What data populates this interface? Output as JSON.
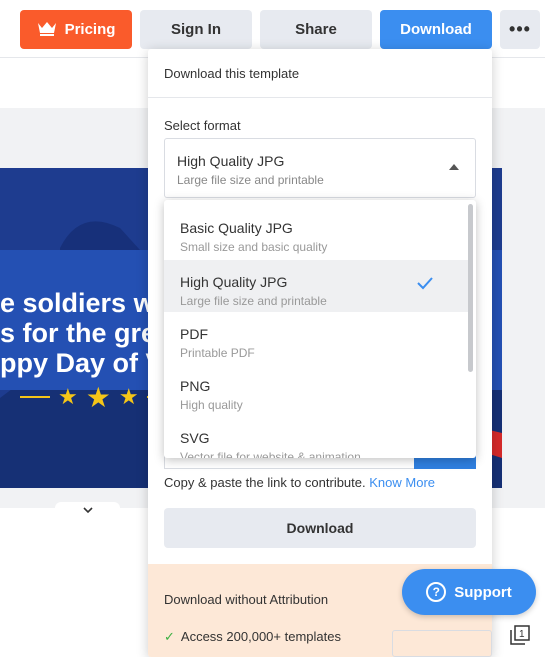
{
  "topbar": {
    "pricing_label": "Pricing",
    "signin_label": "Sign In",
    "share_label": "Share",
    "download_label": "Download",
    "more_label": "•••"
  },
  "banner": {
    "line1": "e soldiers wh",
    "line2": "s for the gre",
    "line3": "ppy Day of Va"
  },
  "popover": {
    "title": "Download this template",
    "select_label": "Select format",
    "selected": {
      "label": "High Quality JPG",
      "sub": "Large file size and printable"
    },
    "copy_text": "Copy & paste the link to contribute.",
    "know_more": "Know More",
    "download_button": "Download",
    "attribution_title": "Download without Attribution",
    "attribution_item": "Access 200,000+ templates"
  },
  "dropdown": {
    "options": [
      {
        "label": "Basic Quality JPG",
        "sub": "Small size and basic quality"
      },
      {
        "label": "High Quality JPG",
        "sub": "Large file size and printable"
      },
      {
        "label": "PDF",
        "sub": "Printable PDF"
      },
      {
        "label": "PNG",
        "sub": "High quality"
      },
      {
        "label": "SVG",
        "sub": "Vector file for website & animation"
      }
    ],
    "selected_index": 1
  },
  "support_label": "Support",
  "pages_count": "1",
  "colors": {
    "accent": "#3b8ef0",
    "pricing": "#fa5b2b",
    "banner": "#1e3c8f"
  }
}
